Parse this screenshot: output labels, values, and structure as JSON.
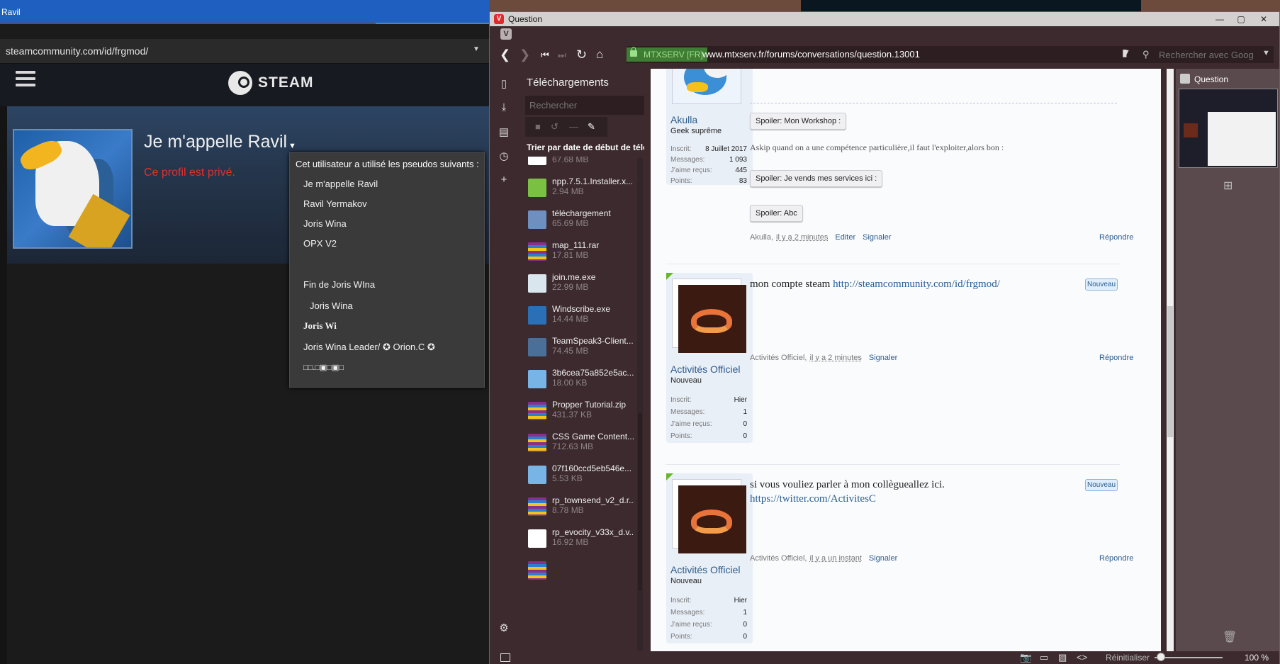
{
  "left_window": {
    "title": "Ravil",
    "url": "steamcommunity.com/id/frgmod/",
    "steam_logo_text": "STEAM",
    "persona_name": "Je m'appelle Ravil",
    "private_text": "Ce profil est privé.",
    "alias_popup": {
      "title": "Cet utilisateur a utilisé les pseudos suivants :",
      "aliases": [
        "Je m'appelle Ravil",
        "Ravil Yermakov",
        "Joris Wina",
        "OPX V2",
        "Fin de Joris WIna",
        "Joris Wina",
        "Joris Wi",
        "Joris Wina Leader/ ✪ Orion.C ✪",
        "□□.□▣□▣□"
      ]
    }
  },
  "browser": {
    "title": "Question",
    "site_badge": "MTXSERV [FR]",
    "url": "www.mtxserv.fr/forums/conversations/question.13001",
    "search_placeholder": "Rechercher avec Goog",
    "downloads": {
      "title": "Téléchargements",
      "search_placeholder": "Rechercher",
      "sort_label": "Trier par date de début de télé",
      "items": [
        {
          "name": "",
          "size": "67.68 MB",
          "icon": "file-icon",
          "color": "#ffffff"
        },
        {
          "name": "npp.7.5.1.Installer.x...",
          "size": "2.94 MB",
          "icon": "notepad-icon",
          "color": "#7ac143"
        },
        {
          "name": "téléchargement",
          "size": "65.69 MB",
          "icon": "windows-installer-icon",
          "color": "#6e8fbf"
        },
        {
          "name": "map_111.rar",
          "size": "17.81 MB",
          "icon": "rar-archive-icon",
          "color": "#8b2f8b"
        },
        {
          "name": "join.me.exe",
          "size": "22.99 MB",
          "icon": "exe-icon",
          "color": "#d9e6ee"
        },
        {
          "name": "Windscribe.exe",
          "size": "14.44 MB",
          "icon": "windscribe-icon",
          "color": "#2b6fb6"
        },
        {
          "name": "TeamSpeak3-Client...",
          "size": "74.45 MB",
          "icon": "teamspeak-icon",
          "color": "#4a6f99"
        },
        {
          "name": "3b6cea75a852e5ac...",
          "size": "18.00 KB",
          "icon": "image-icon",
          "color": "#78b4e6"
        },
        {
          "name": "Propper Tutorial.zip",
          "size": "431.37 KB",
          "icon": "rar-archive-icon",
          "color": "#8b2f8b"
        },
        {
          "name": "CSS Game Content...",
          "size": "712.63 MB",
          "icon": "rar-archive-icon",
          "color": "#8b2f8b"
        },
        {
          "name": "07f160ccd5eb546e...",
          "size": "5.53 KB",
          "icon": "image-icon",
          "color": "#78b4e6"
        },
        {
          "name": "rp_townsend_v2_d.r...",
          "size": "8.78 MB",
          "icon": "rar-archive-icon",
          "color": "#8b2f8b"
        },
        {
          "name": "rp_evocity_v33x_d.v...",
          "size": "16.92 MB",
          "icon": "file-icon",
          "color": "#ffffff"
        },
        {
          "name": "",
          "size": "",
          "icon": "rar-archive-icon",
          "color": "#8b2f8b"
        }
      ]
    },
    "forum": {
      "post1": {
        "user": "Akulla",
        "user_title": "Geek suprême",
        "stats": [
          [
            "Inscrit:",
            "8 Juillet 2017"
          ],
          [
            "Messages:",
            "1 093"
          ],
          [
            "J'aime reçus:",
            "445"
          ],
          [
            "Points:",
            "83"
          ]
        ],
        "spoiler1": "Spoiler: Mon Workshop :",
        "line": "Askip quand on a une compétence particulière,il faut l'exploiter,alors bon :",
        "spoiler2": "Spoiler: Je vends mes services ici :",
        "spoiler3": "Spoiler: Abc",
        "meta_user": "Akulla,",
        "meta_time": "il y a 2 minutes",
        "edit": "Editer",
        "report": "Signaler",
        "reply": "Répondre"
      },
      "post2": {
        "user": "Activités Officiel",
        "user_title": "Nouveau",
        "stats": [
          [
            "Inscrit:",
            "Hier"
          ],
          [
            "Messages:",
            "1"
          ],
          [
            "J'aime reçus:",
            "0"
          ],
          [
            "Points:",
            "0"
          ]
        ],
        "text": "mon compte steam ",
        "link": "http://steamcommunity.com/id/frgmod/",
        "badge": "Nouveau",
        "meta_user": "Activités Officiel,",
        "meta_time": "il y a 2 minutes",
        "report": "Signaler",
        "reply": "Répondre"
      },
      "post3": {
        "user": "Activités Officiel",
        "user_title": "Nouveau",
        "stats": [
          [
            "Inscrit:",
            "Hier"
          ],
          [
            "Messages:",
            "1"
          ],
          [
            "J'aime reçus:",
            "0"
          ],
          [
            "Points:",
            "0"
          ]
        ],
        "text": "si vous vouliez parler à mon collègueallez ici.",
        "link": "https://twitter.com/ActivitesC",
        "badge": "Nouveau",
        "meta_user": "Activités Officiel,",
        "meta_time": "il y a un instant",
        "report": "Signaler",
        "reply": "Répondre"
      }
    },
    "tab_panel": {
      "tab_label": "Question"
    },
    "statusbar": {
      "reset_label": "Réinitialiser",
      "zoom": "100 %"
    }
  }
}
